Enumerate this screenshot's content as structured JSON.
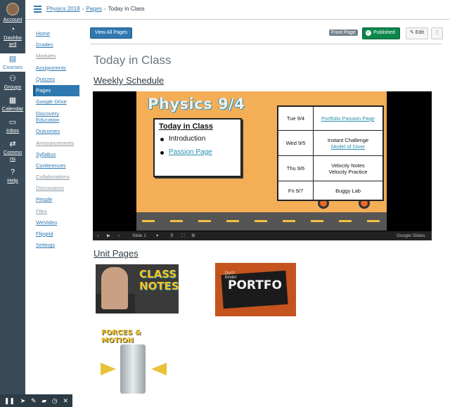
{
  "global_nav": [
    {
      "label": "Account",
      "icon": "avatar"
    },
    {
      "label": "Dashboard",
      "icon": "dashboard-icon"
    },
    {
      "label": "Courses",
      "icon": "courses-icon",
      "active": true
    },
    {
      "label": "Groups",
      "icon": "groups-icon"
    },
    {
      "label": "Calendar",
      "icon": "calendar-icon"
    },
    {
      "label": "Inbox",
      "icon": "inbox-icon"
    },
    {
      "label": "Commons",
      "icon": "commons-icon"
    },
    {
      "label": "Help",
      "icon": "help-icon"
    }
  ],
  "breadcrumb": [
    "Physics 2018",
    "Pages",
    "Today in Class"
  ],
  "course_nav": [
    {
      "label": "Home"
    },
    {
      "label": "Grades"
    },
    {
      "label": "Modules"
    },
    {
      "label": "Assignments"
    },
    {
      "label": "Quizzes"
    },
    {
      "label": "Pages",
      "active": true
    },
    {
      "label": "Google Drive"
    },
    {
      "label": "Discovery Education"
    },
    {
      "label": "Outcomes"
    },
    {
      "label": "Announcements"
    },
    {
      "label": "Syllabus"
    },
    {
      "label": "Conferences"
    },
    {
      "label": "Collaborations"
    },
    {
      "label": "Discussions"
    },
    {
      "label": "People"
    },
    {
      "label": "Files"
    },
    {
      "label": "WeVideo"
    },
    {
      "label": "Flipgrid"
    },
    {
      "label": "Settings"
    }
  ],
  "toolbar": {
    "view_all": "View All Pages",
    "front_page": "Front Page",
    "published": "Published",
    "edit": "Edit",
    "more": "⋮"
  },
  "page": {
    "title": "Today in Class",
    "weekly_heading": "Weekly Schedule",
    "unit_heading": "Unit Pages"
  },
  "slide": {
    "title": "Physics 9/4",
    "box_title": "Today in Class",
    "bullets": [
      "Introduction",
      "Passion Page"
    ],
    "schedule": [
      {
        "day": "Tue 9/4",
        "lines": [
          "Portfolio Passion Page"
        ],
        "link": true
      },
      {
        "day": "Wed 9/5",
        "lines": [
          "Instant Challenge",
          "Model of Diver"
        ],
        "link_second": true
      },
      {
        "day": "Thu 9/6",
        "lines": [
          "Velocity Notes",
          "Velocity Practice"
        ]
      },
      {
        "day": "Fri 9/7",
        "lines": [
          "Buggy Lab"
        ]
      }
    ],
    "controls": {
      "slide_label": "Slide 1",
      "brand": "Google Slides"
    }
  },
  "thumbs": {
    "class_notes": "CLASS NOTES",
    "portfolio_small": "Don't binder",
    "portfolio": "PORTFO",
    "forces": "FORCES & MOTION"
  },
  "colors": {
    "nav_bg": "#394b58",
    "accent": "#2f78b0",
    "published": "#0b874b",
    "slide_bg": "#f4ae56"
  }
}
